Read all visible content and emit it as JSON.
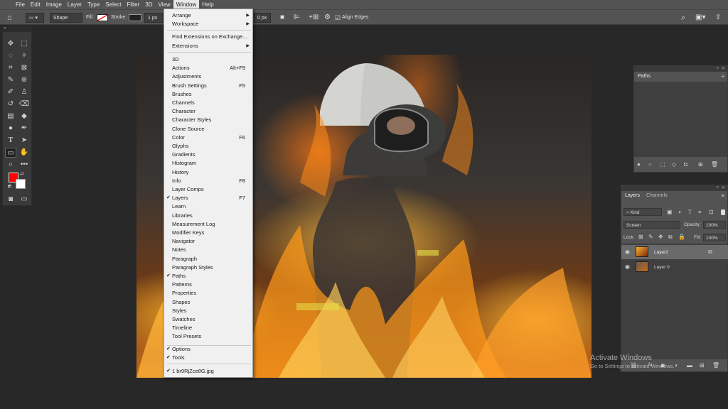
{
  "menubar": {
    "items": [
      "File",
      "Edit",
      "Image",
      "Layer",
      "Type",
      "Select",
      "Filter",
      "3D",
      "View",
      "Window",
      "Help"
    ],
    "open_item": "Window"
  },
  "options": {
    "mode": "Shape",
    "fill_label": "Fill:",
    "stroke_label": "Stroke:",
    "stroke_width": "1 px",
    "height_value": "0 px",
    "align_edges": "Align Edges"
  },
  "window_menu": {
    "arrange": "Arrange",
    "workspace": "Workspace",
    "find_extensions": "Find Extensions on Exchange...",
    "extensions": "Extensions",
    "items": [
      {
        "label": "3D",
        "shortcut": "",
        "checked": false
      },
      {
        "label": "Actions",
        "shortcut": "Alt+F9",
        "checked": false
      },
      {
        "label": "Adjustments",
        "shortcut": "",
        "checked": false
      },
      {
        "label": "Brush Settings",
        "shortcut": "F5",
        "checked": false
      },
      {
        "label": "Brushes",
        "shortcut": "",
        "checked": false
      },
      {
        "label": "Channels",
        "shortcut": "",
        "checked": false
      },
      {
        "label": "Character",
        "shortcut": "",
        "checked": false
      },
      {
        "label": "Character Styles",
        "shortcut": "",
        "checked": false
      },
      {
        "label": "Clone Source",
        "shortcut": "",
        "checked": false
      },
      {
        "label": "Color",
        "shortcut": "F6",
        "checked": false
      },
      {
        "label": "Glyphs",
        "shortcut": "",
        "checked": false
      },
      {
        "label": "Gradients",
        "shortcut": "",
        "checked": false
      },
      {
        "label": "Histogram",
        "shortcut": "",
        "checked": false
      },
      {
        "label": "History",
        "shortcut": "",
        "checked": false
      },
      {
        "label": "Info",
        "shortcut": "F8",
        "checked": false
      },
      {
        "label": "Layer Comps",
        "shortcut": "",
        "checked": false
      },
      {
        "label": "Layers",
        "shortcut": "F7",
        "checked": true
      },
      {
        "label": "Learn",
        "shortcut": "",
        "checked": false
      },
      {
        "label": "Libraries",
        "shortcut": "",
        "checked": false
      },
      {
        "label": "Measurement Log",
        "shortcut": "",
        "checked": false
      },
      {
        "label": "Modifier Keys",
        "shortcut": "",
        "checked": false
      },
      {
        "label": "Navigator",
        "shortcut": "",
        "checked": false
      },
      {
        "label": "Notes",
        "shortcut": "",
        "checked": false
      },
      {
        "label": "Paragraph",
        "shortcut": "",
        "checked": false
      },
      {
        "label": "Paragraph Styles",
        "shortcut": "",
        "checked": false
      },
      {
        "label": "Paths",
        "shortcut": "",
        "checked": true
      },
      {
        "label": "Patterns",
        "shortcut": "",
        "checked": false
      },
      {
        "label": "Properties",
        "shortcut": "",
        "checked": false
      },
      {
        "label": "Shapes",
        "shortcut": "",
        "checked": false
      },
      {
        "label": "Styles",
        "shortcut": "",
        "checked": false
      },
      {
        "label": "Swatches",
        "shortcut": "",
        "checked": false
      },
      {
        "label": "Timeline",
        "shortcut": "",
        "checked": false
      },
      {
        "label": "Tool Presets",
        "shortcut": "",
        "checked": false
      }
    ],
    "options_item": "Options",
    "tools_item": "Tools",
    "document_item": "1 br9RjZce8G.jpg"
  },
  "paths_panel": {
    "tab": "Paths"
  },
  "layers_panel": {
    "tabs": [
      "Layers",
      "Channels"
    ],
    "kind": "Kind",
    "blend_mode": "Screen",
    "opacity_label": "Opacity:",
    "opacity_value": "100%",
    "lock_label": "Lock:",
    "fill_label": "Fill:",
    "fill_value": "100%",
    "layers": [
      {
        "name": "Layer2",
        "selected": true
      },
      {
        "name": "Layer 0",
        "selected": false
      }
    ]
  },
  "watermark": {
    "title": "Activate Windows",
    "subtitle": "Go to Settings to activate Windows."
  },
  "colors": {
    "foreground": "#ff0000",
    "background": "#ffffff",
    "ui_dark": "#282828",
    "ui_panel": "#535353"
  }
}
